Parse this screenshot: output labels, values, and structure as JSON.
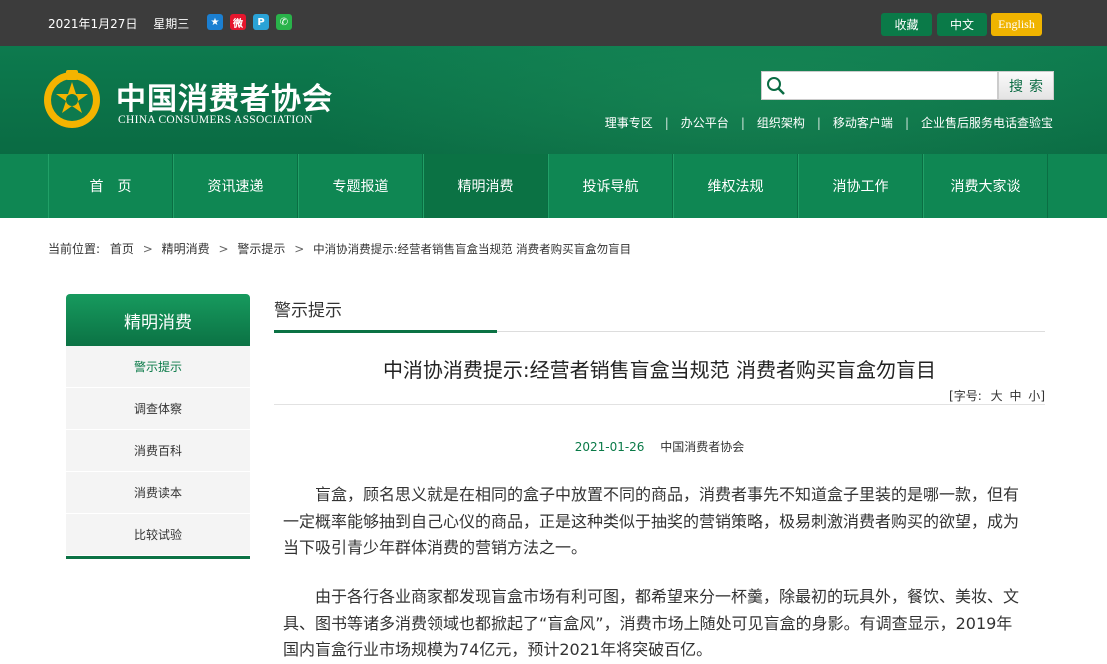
{
  "topbar": {
    "date": "2021年1月27日",
    "weekday": "星期三",
    "share_icons": [
      "qzone-icon",
      "weibo-icon",
      "tencent-weibo-icon",
      "wechat-icon"
    ],
    "favorite": "收藏",
    "chinese": "中文",
    "english": "English"
  },
  "header": {
    "logo_cn": "中国消费者协会",
    "logo_en": "CHINA CONSUMERS ASSOCIATION",
    "search_placeholder": "",
    "search_button": "搜索",
    "quick_links": [
      "理事专区",
      "办公平台",
      "组织架构",
      "移动客户端",
      "企业售后服务电话查验宝"
    ]
  },
  "nav": {
    "items": [
      "首　页",
      "资讯速递",
      "专题报道",
      "精明消费",
      "投诉导航",
      "维权法规",
      "消协工作",
      "消费大家谈"
    ],
    "active_index": 3
  },
  "breadcrumb": {
    "prefix": "当前位置:",
    "items": [
      "首页",
      "精明消费",
      "警示提示",
      "中消协消费提示:经营者销售盲盒当规范 消费者购买盲盒勿盲目"
    ]
  },
  "sidebar": {
    "title": "精明消费",
    "items": [
      "警示提示",
      "调查体察",
      "消费百科",
      "消费读本",
      "比较试验"
    ],
    "current_index": 0
  },
  "section": {
    "title": "警示提示"
  },
  "article": {
    "title": "中消协消费提示:经营者销售盲盒当规范 消费者购买盲盒勿盲目",
    "font_size_label": "[字号:",
    "font_size_options": [
      "大",
      "中",
      "小"
    ],
    "font_size_end": "]",
    "date": "2021-01-26",
    "source": "中国消费者协会",
    "paragraphs": [
      "盲盒，顾名思义就是在相同的盒子中放置不同的商品，消费者事先不知道盒子里装的是哪一款，但有一定概率能够抽到自己心仪的商品，正是这种类似于抽奖的营销策略，极易刺激消费者购买的欲望，成为当下吸引青少年群体消费的营销方法之一。",
      "由于各行各业商家都发现盲盒市场有利可图，都希望来分一杯羹，除最初的玩具外，餐饮、美妆、文具、图书等诸多消费领域也都掀起了“盲盒风”，消费市场上随处可见盲盒的身影。有调查显示，2019年国内盲盒行业市场规模为74亿元，预计2021年将突破百亿。"
    ]
  },
  "colors": {
    "green": "#0b7244",
    "nav": "#0f8753",
    "gold": "#f0b400",
    "topbar": "#3c3c3c"
  }
}
